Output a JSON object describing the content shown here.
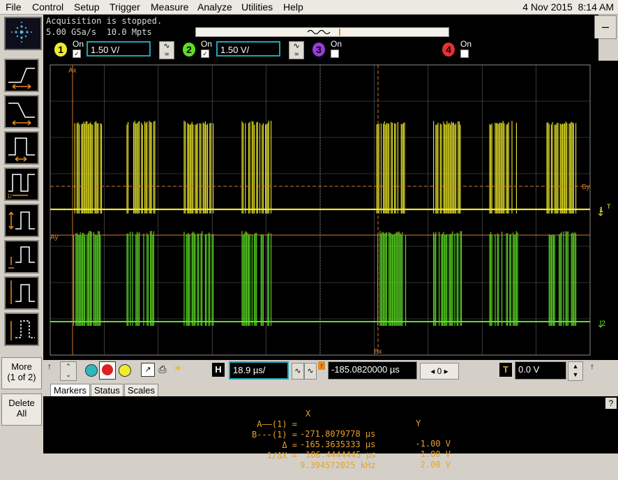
{
  "menu": [
    "File",
    "Control",
    "Setup",
    "Trigger",
    "Measure",
    "Analyze",
    "Utilities",
    "Help"
  ],
  "datetime": {
    "date": "4 Nov 2015",
    "time": "8:14 AM"
  },
  "acquisition": {
    "status": "Acquisition is stopped.",
    "rate": "5.00 GSa/s",
    "mpts": "10.0 Mpts"
  },
  "channels": [
    {
      "num": "1",
      "on_label": "On",
      "checked": true,
      "scale": "1.50 V/",
      "color": "#f0ec2a"
    },
    {
      "num": "2",
      "on_label": "On",
      "checked": true,
      "scale": "1.50 V/",
      "color": "#5ee024"
    },
    {
      "num": "3",
      "on_label": "On",
      "checked": false,
      "color": "#9a3ad8"
    },
    {
      "num": "4",
      "on_label": "On",
      "checked": false,
      "color": "#e83030"
    }
  ],
  "scope_labels": {
    "ax": "Ax",
    "ay": "Ay",
    "by": "By",
    "bx": "Bx"
  },
  "side_buttons": {
    "more_line1": "More",
    "more_line2": "(1 of 2)",
    "delete_line1": "Delete",
    "delete_line2": "All"
  },
  "timebase": {
    "h_label": "H",
    "scale": "18.9 µs/",
    "t_label": "T",
    "position": "-185.0820000 µs",
    "stepper": "0",
    "trigger_level": "0.0 V"
  },
  "tabs": [
    "Markers",
    "Status",
    "Scales"
  ],
  "markers": {
    "header_x": "X",
    "header_y": "Y",
    "rows": [
      {
        "label": "A——(1) =",
        "x": "-271.8079778 µs",
        "y": "-1.00 V"
      },
      {
        "label": "B---(1) =",
        "x": "-165.3635333 µs",
        "y": "1.00 V"
      },
      {
        "label": "Δ =",
        "x": "106.4444445 µs",
        "y": "2.00 V"
      },
      {
        "label": "1/ΔX =",
        "x": "9.394572025 kHz",
        "y": ""
      }
    ]
  },
  "help_label": "?",
  "trace_colors": {
    "ch1": "#f0ec2a",
    "ch2": "#5ee024",
    "marker": "#d07a30",
    "grid": "#8a8a8a"
  }
}
